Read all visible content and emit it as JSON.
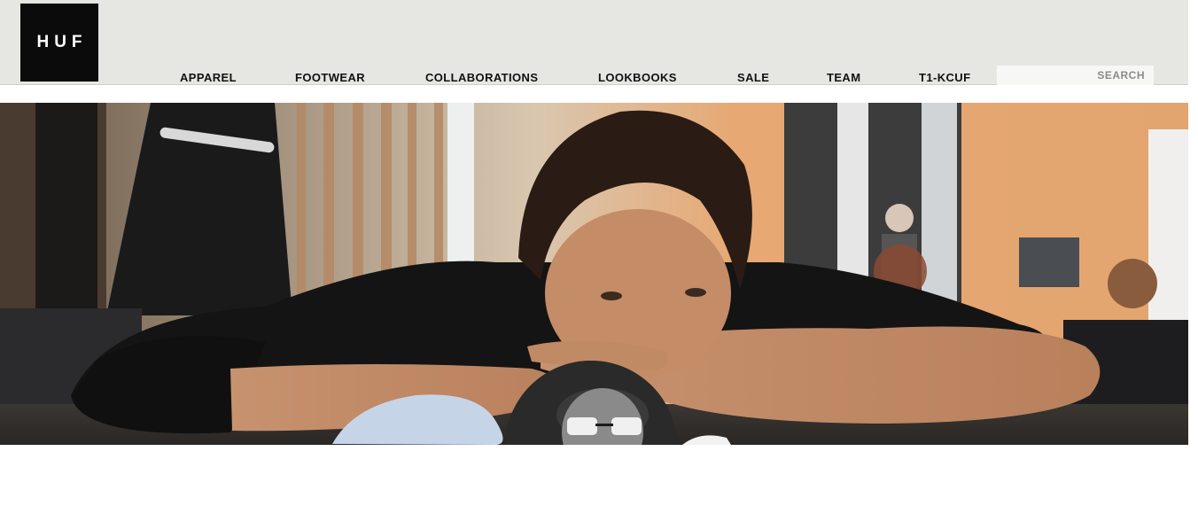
{
  "brand": {
    "logo_text": "HUF"
  },
  "nav": {
    "items": [
      {
        "label": "APPAREL"
      },
      {
        "label": "FOOTWEAR"
      },
      {
        "label": "COLLABORATIONS"
      },
      {
        "label": "LOOKBOOKS"
      },
      {
        "label": "SALE"
      },
      {
        "label": "TEAM"
      },
      {
        "label": "T1-KCUF"
      }
    ]
  },
  "search": {
    "placeholder": "SEARCH",
    "icon": "search-field"
  },
  "hero": {
    "image_subject": "hero-photo",
    "avatar": "sunglasses-avatar-photo"
  },
  "colors": {
    "header_bg": "#e6e7e3",
    "logo_bg": "#0b0b0b",
    "nav_text": "#111111"
  }
}
